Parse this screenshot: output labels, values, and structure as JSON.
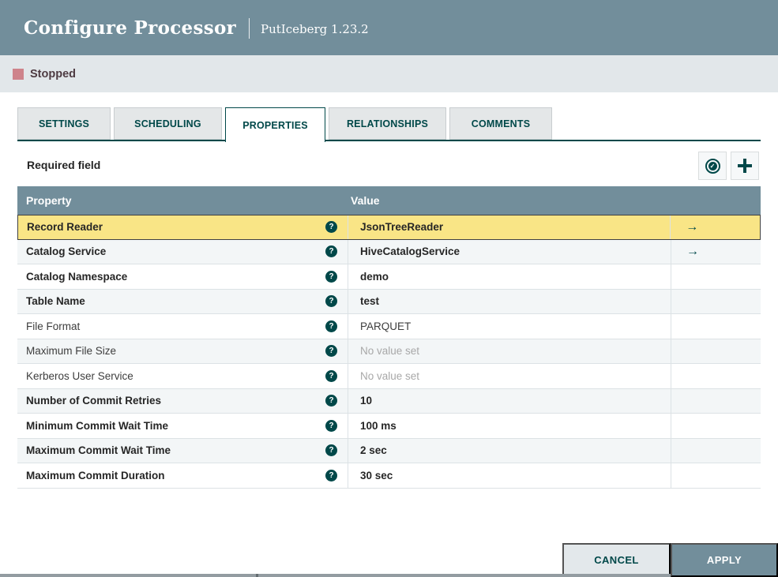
{
  "header": {
    "title": "Configure Processor",
    "subtitle": "PutIceberg 1.23.2"
  },
  "status": {
    "label": "Stopped"
  },
  "tabs": [
    {
      "label": "SETTINGS",
      "active": false
    },
    {
      "label": "SCHEDULING",
      "active": false
    },
    {
      "label": "PROPERTIES",
      "active": true
    },
    {
      "label": "RELATIONSHIPS",
      "active": false
    },
    {
      "label": "COMMENTS",
      "active": false
    }
  ],
  "toolbar": {
    "required_label": "Required field",
    "verify_icon": "check-circle-icon",
    "add_icon": "plus-icon",
    "help_icon_glyph": "?",
    "check_glyph": "✓"
  },
  "table": {
    "columns": {
      "property": "Property",
      "value": "Value"
    },
    "rows": [
      {
        "property": "Record Reader",
        "value": "JsonTreeReader",
        "required": true,
        "selected": true,
        "link": true,
        "value_set": true
      },
      {
        "property": "Catalog Service",
        "value": "HiveCatalogService",
        "required": true,
        "selected": false,
        "link": true,
        "value_set": true
      },
      {
        "property": "Catalog Namespace",
        "value": "demo",
        "required": true,
        "selected": false,
        "link": false,
        "value_set": true
      },
      {
        "property": "Table Name",
        "value": "test",
        "required": true,
        "selected": false,
        "link": false,
        "value_set": true
      },
      {
        "property": "File Format",
        "value": "PARQUET",
        "required": false,
        "selected": false,
        "link": false,
        "value_set": true
      },
      {
        "property": "Maximum File Size",
        "value": "No value set",
        "required": false,
        "selected": false,
        "link": false,
        "value_set": false
      },
      {
        "property": "Kerberos User Service",
        "value": "No value set",
        "required": false,
        "selected": false,
        "link": false,
        "value_set": false
      },
      {
        "property": "Number of Commit Retries",
        "value": "10",
        "required": true,
        "selected": false,
        "link": false,
        "value_set": true
      },
      {
        "property": "Minimum Commit Wait Time",
        "value": "100 ms",
        "required": true,
        "selected": false,
        "link": false,
        "value_set": true
      },
      {
        "property": "Maximum Commit Wait Time",
        "value": "2 sec",
        "required": true,
        "selected": false,
        "link": false,
        "value_set": true
      },
      {
        "property": "Maximum Commit Duration",
        "value": "30 sec",
        "required": true,
        "selected": false,
        "link": false,
        "value_set": true
      }
    ]
  },
  "buttons": {
    "cancel": "CANCEL",
    "apply": "APPLY"
  },
  "colors": {
    "accent": "#004849",
    "slate": "#728E9B",
    "status_bar_bg": "#E2E7EA",
    "stopped_square": "#CE838B",
    "stopped_text": "#4E3B42",
    "selected_row_bg": "#F9E586",
    "selected_row_border": "#404040",
    "row_alt_bg": "#F3F6F7",
    "unset_text": "#A8A8A8",
    "canvas_edge": "#939CA1"
  }
}
